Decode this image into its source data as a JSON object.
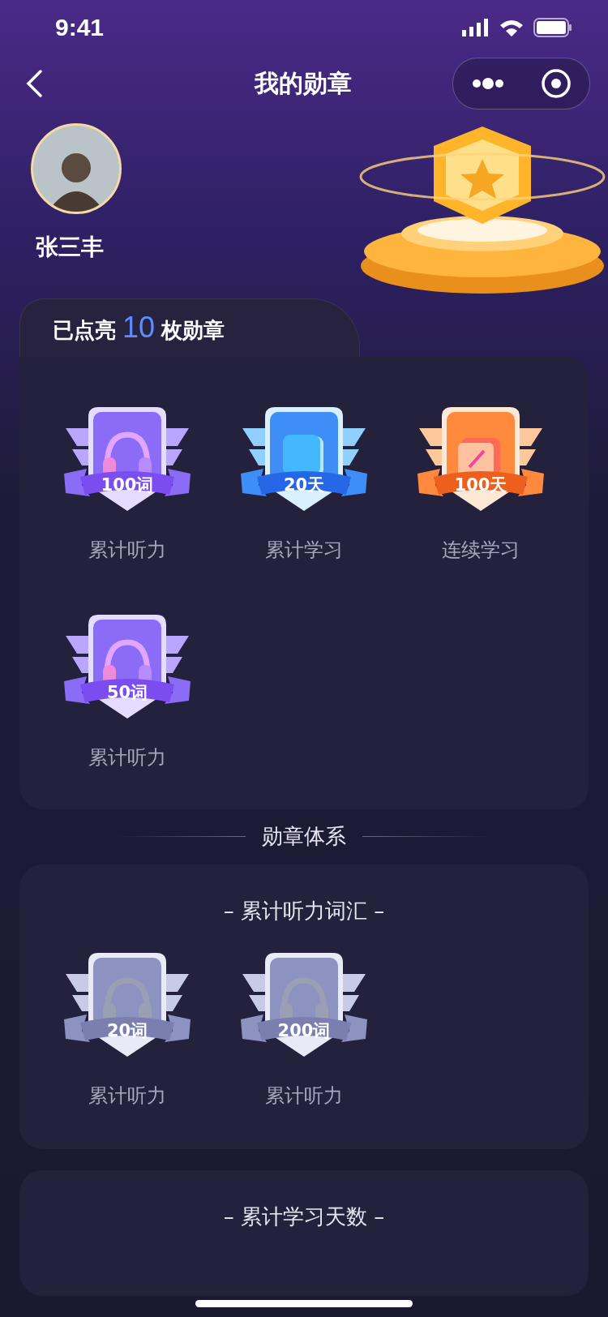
{
  "status_bar": {
    "time": "9:41"
  },
  "nav": {
    "title": "我的勋章"
  },
  "profile": {
    "name": "张三丰"
  },
  "earned_card": {
    "prefix": "已点亮",
    "count": "10",
    "suffix": "枚勋章",
    "badges": [
      {
        "kind": "listening",
        "earned": true,
        "value": "100词",
        "label": "累计听力"
      },
      {
        "kind": "study",
        "earned": true,
        "value": "20天",
        "label": "累计学习"
      },
      {
        "kind": "streak",
        "earned": true,
        "value": "100天",
        "label": "连续学习"
      },
      {
        "kind": "listening",
        "earned": true,
        "value": "50词",
        "label": "累计听力"
      }
    ]
  },
  "system_heading": "勋章体系",
  "sections": [
    {
      "title": "– 累计听力词汇 –",
      "badges": [
        {
          "kind": "listening",
          "earned": false,
          "value": "20词",
          "label": "累计听力"
        },
        {
          "kind": "listening",
          "earned": false,
          "value": "200词",
          "label": "累计听力"
        }
      ]
    },
    {
      "title": "– 累计学习天数 –"
    }
  ]
}
